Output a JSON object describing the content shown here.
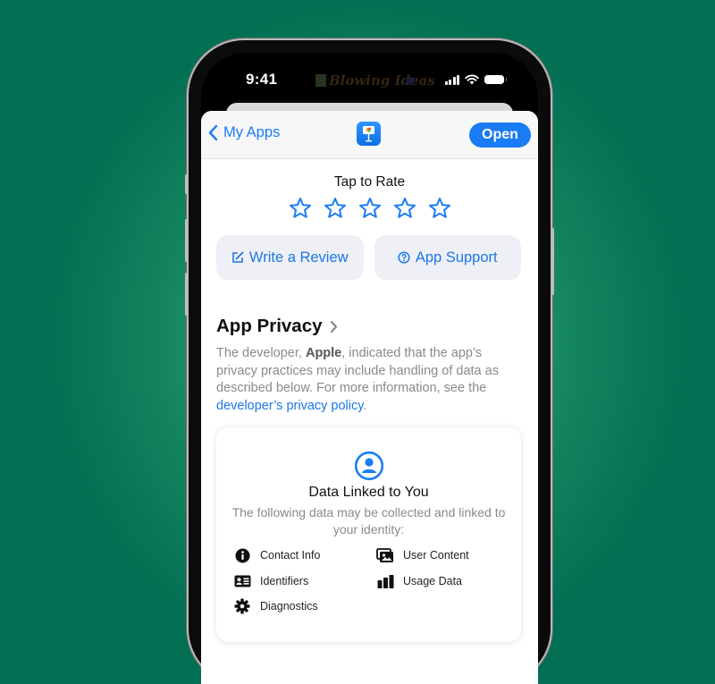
{
  "status_bar": {
    "time": "9:41",
    "watermark": "Blowing Ideas"
  },
  "nav": {
    "back_label": "My Apps",
    "app_icon": "keynote-app-icon",
    "open_label": "Open"
  },
  "rating": {
    "title": "Tap to Rate",
    "stars_total": 5,
    "stars_selected": 0
  },
  "actions": {
    "write_review_label": "Write a Review",
    "app_support_label": "App Support"
  },
  "privacy": {
    "title": "App Privacy",
    "desc_prefix": "The developer, ",
    "developer": "Apple",
    "desc_middle": ", indicated that the app’s privacy practices may include handling of data as described below. For more information, see the ",
    "policy_link": "developer’s privacy policy",
    "desc_suffix": "."
  },
  "card": {
    "title": "Data Linked to You",
    "description": "The following data may be collected and linked to your identity:",
    "items": [
      {
        "label": "Contact Info",
        "icon": "info-circle-icon"
      },
      {
        "label": "User Content",
        "icon": "photos-icon"
      },
      {
        "label": "Identifiers",
        "icon": "id-card-icon"
      },
      {
        "label": "Usage Data",
        "icon": "bar-chart-icon"
      },
      {
        "label": "Diagnostics",
        "icon": "gear-icon"
      }
    ]
  },
  "colors": {
    "accent": "#1a7cf4",
    "background_outer": "#026f52",
    "background_center": "#36b484"
  }
}
